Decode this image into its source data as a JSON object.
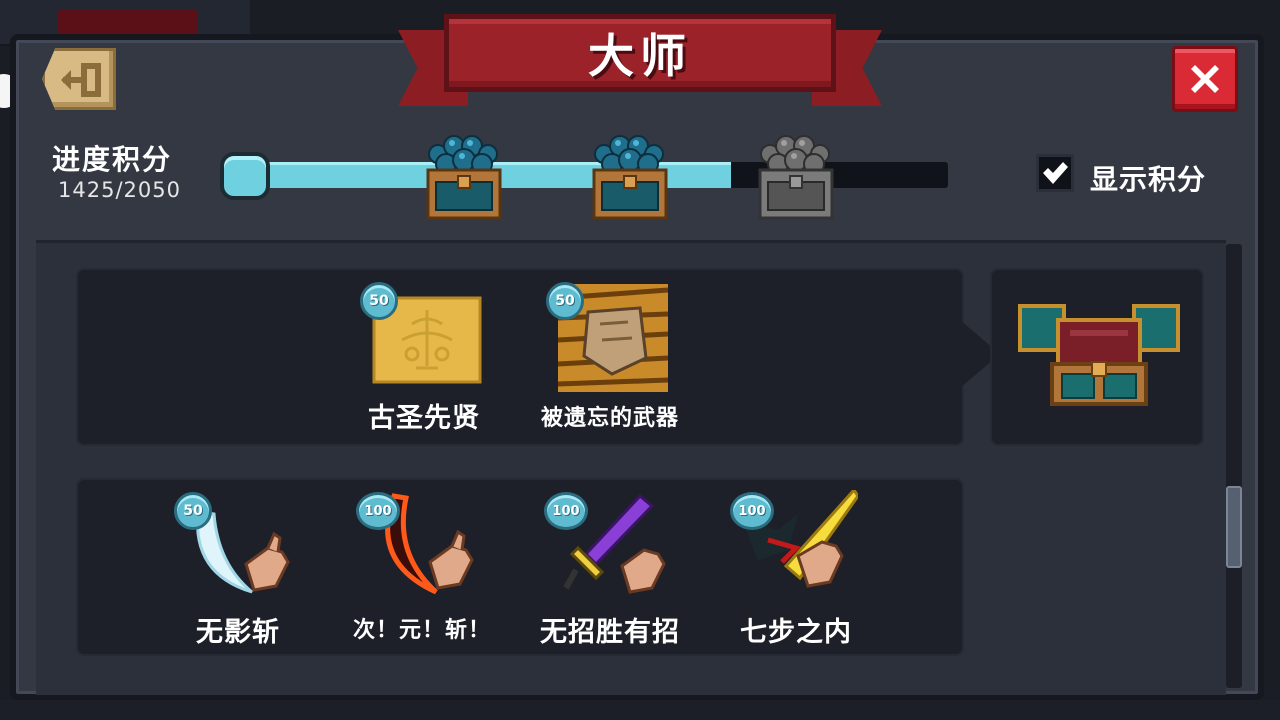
{
  "title": "大师",
  "progress": {
    "label": "进度积分",
    "value_text": "1425/2050",
    "current": 1425,
    "max": 2050,
    "milestones": [
      {
        "icon": "gem-chest-icon",
        "reached": true
      },
      {
        "icon": "gem-chest-icon",
        "reached": true
      },
      {
        "icon": "gem-chest-icon",
        "reached": false
      }
    ]
  },
  "show_points": {
    "label": "显示积分",
    "checked": true
  },
  "groups": [
    {
      "skills": [
        {
          "name": "古圣先贤",
          "points": "50",
          "icon": "ancient-sage-map-icon"
        },
        {
          "name": "被遗忘的武器",
          "points": "50",
          "icon": "forgotten-weapon-icon"
        }
      ],
      "reward": {
        "icon": "treasure-chest-icon"
      }
    },
    {
      "skills": [
        {
          "name": "无影斩",
          "points": "50",
          "icon": "shadowless-slash-icon"
        },
        {
          "name": "次！元！斩！",
          "points": "100",
          "icon": "dimension-slash-icon"
        },
        {
          "name": "无招胜有招",
          "points": "100",
          "icon": "sword-purple-icon"
        },
        {
          "name": "七步之内",
          "points": "100",
          "icon": "golden-blade-icon"
        }
      ]
    }
  ],
  "colors": {
    "panel": "#333843",
    "banner": "#9a2228",
    "progress_fill": "#6fd0e0",
    "badge": "#5fbcd0",
    "close": "#d92a35"
  }
}
